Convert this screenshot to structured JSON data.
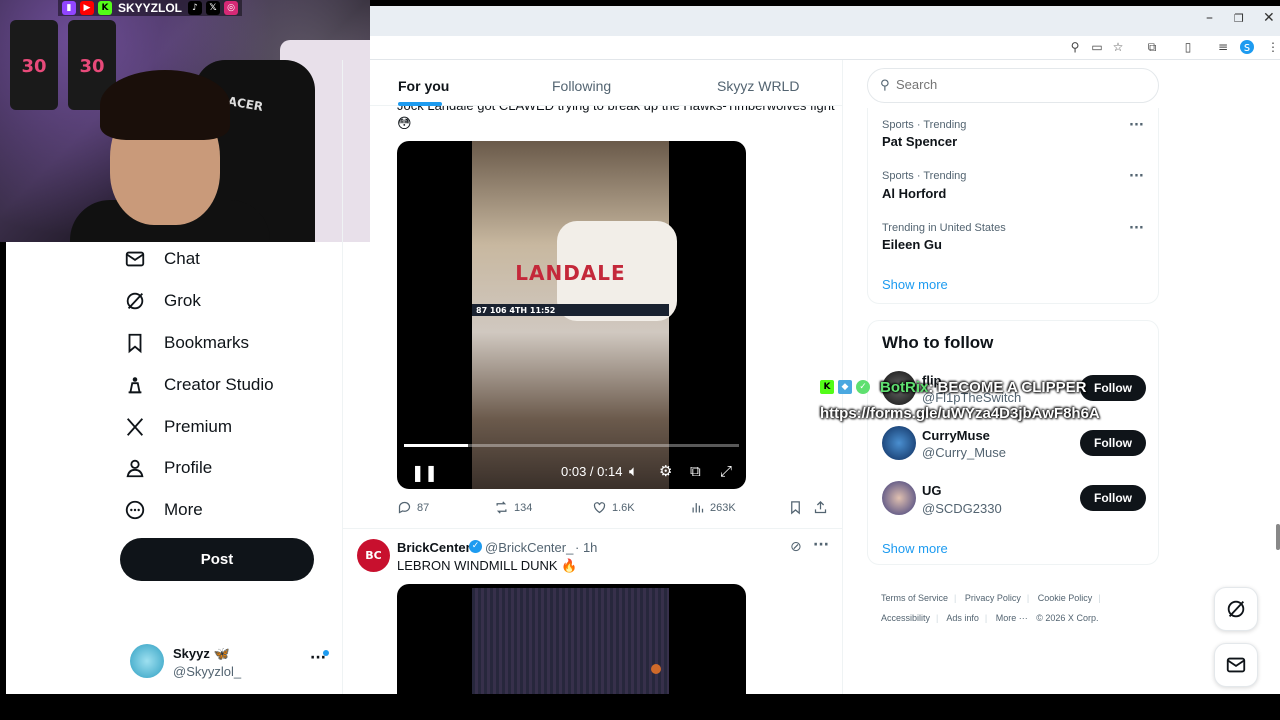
{
  "overlay_top": {
    "streamer_name": "SKYYZLOL",
    "social_icons": [
      "twitch-icon",
      "youtube-icon",
      "kick-icon",
      "tiktok-icon",
      "x-icon",
      "instagram-icon"
    ]
  },
  "window_controls": {
    "minimize": "–",
    "restore": "❐",
    "close": "✕"
  },
  "nav": {
    "items": [
      {
        "label": "Chat",
        "icon": "mail-icon"
      },
      {
        "label": "Grok",
        "icon": "grok-icon"
      },
      {
        "label": "Bookmarks",
        "icon": "bookmark-icon"
      },
      {
        "label": "Creator Studio",
        "icon": "creator-studio-icon"
      },
      {
        "label": "Premium",
        "icon": "x-logo-icon"
      },
      {
        "label": "Profile",
        "icon": "person-icon"
      },
      {
        "label": "More",
        "icon": "more-circle-icon"
      }
    ],
    "post_label": "Post"
  },
  "account": {
    "name": "Skyyz 🦋",
    "handle": "@Skyyzlol_",
    "more": "···"
  },
  "feed": {
    "tabs": [
      {
        "label": "For you",
        "active": true
      },
      {
        "label": "Following",
        "active": false
      },
      {
        "label": "Skyyz WRLD",
        "active": false
      }
    ],
    "tweet1": {
      "text": "Jock Landale got CLAWED trying to break up the Hawks-Timberwolves fight",
      "emoji": "😳",
      "video": {
        "player_name": "LANDALE",
        "scoreboard": "87   106   4TH 11:52",
        "time": "0:03 / 0:14",
        "progress_fraction": 0.19
      },
      "replies": "87",
      "reposts": "134",
      "likes": "1.6K",
      "views": "263K"
    },
    "tweet2": {
      "avatar_text": "BC",
      "name": "BrickCenter",
      "handle": "@BrickCenter_",
      "time": "· 1h",
      "text": "LEBRON WINDMILL DUNK 🔥"
    }
  },
  "sidebar": {
    "search_placeholder": "Search",
    "trends": [
      {
        "context": "Sports · Trending",
        "name": "Pat Spencer"
      },
      {
        "context": "Sports · Trending",
        "name": "Al Horford"
      },
      {
        "context": "Trending in United States",
        "name": "Eileen Gu"
      }
    ],
    "trends_show_more": "Show more",
    "who_to_follow": {
      "title": "Who to follow",
      "users": [
        {
          "name": "flip",
          "handle": "@Fl1pTheSwitch",
          "button": "Follow"
        },
        {
          "name": "CurryMuse",
          "handle": "@Curry_Muse",
          "button": "Follow"
        },
        {
          "name": "UG",
          "handle": "@SCDG2330",
          "button": "Follow"
        }
      ],
      "show_more": "Show more"
    },
    "footer": {
      "links": [
        "Terms of Service",
        "Privacy Policy",
        "Cookie Policy",
        "Accessibility",
        "Ads info",
        "More ···"
      ],
      "copyright": "© 2026 X Corp."
    }
  },
  "stream_overlay": {
    "bot_name": "BotRix",
    "message": "BECOME A CLIPPER",
    "url": "https://forms.gle/uWYza4D3jbAwF8h6A"
  },
  "colors": {
    "accent": "#1d9bf0",
    "text": "#0f1419",
    "muted": "#536471"
  }
}
